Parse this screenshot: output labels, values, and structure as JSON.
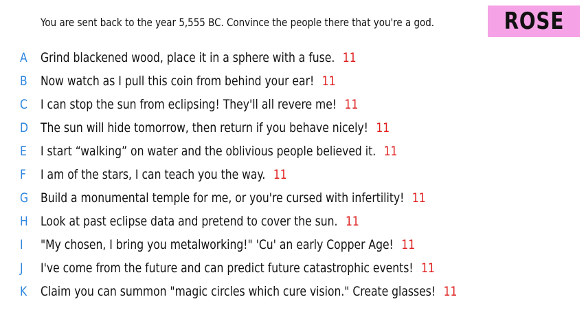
{
  "prompt": "You are sent back to the year 5,555 BC. Convince the people there that you're a god.",
  "badge": "ROSE",
  "colors": {
    "letter": "#2e86de",
    "points": "#e02020",
    "badge_bg": "#f5a3e6"
  },
  "answers": [
    {
      "letter": "A",
      "text": "Grind blackened wood, place it in a sphere with a fuse.",
      "points": "11"
    },
    {
      "letter": "B",
      "text": "Now watch as I pull this coin from behind your ear!",
      "points": "11"
    },
    {
      "letter": "C",
      "text": "I can stop the sun from eclipsing! They'll all revere me!",
      "points": "11"
    },
    {
      "letter": "D",
      "text": "The sun will hide tomorrow, then return if you behave nicely!",
      "points": "11"
    },
    {
      "letter": "E",
      "text": "I start “walking” on water and the oblivious people believed it.",
      "points": "11"
    },
    {
      "letter": "F",
      "text": "I am of the stars, I can teach you the way.",
      "points": "11"
    },
    {
      "letter": "G",
      "text": "Build a monumental temple for me, or you're cursed with infertility!",
      "points": "11"
    },
    {
      "letter": "H",
      "text": "Look at past eclipse data and pretend to cover the sun.",
      "points": "11"
    },
    {
      "letter": "I",
      "text": "\"My chosen, I bring you metalworking!\" 'Cu' an early Copper Age!",
      "points": "11"
    },
    {
      "letter": "J",
      "text": "I've come from the future and can predict future catastrophic events!",
      "points": "11"
    },
    {
      "letter": "K",
      "text": "Claim you can summon \"magic circles which cure vision.\" Create glasses!",
      "points": "11"
    }
  ]
}
